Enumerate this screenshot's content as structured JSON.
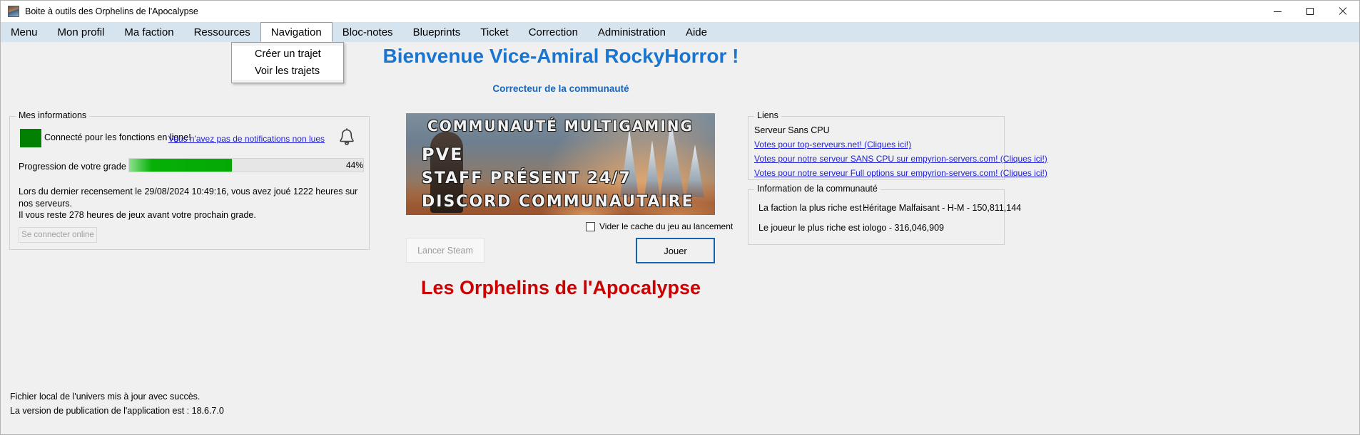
{
  "window": {
    "title": "Boite à outils des Orphelins de l'Apocalypse",
    "minimize": "—",
    "maximize": "▢",
    "close": "✕"
  },
  "menubar": {
    "items": [
      {
        "label": "Menu"
      },
      {
        "label": "Mon profil"
      },
      {
        "label": "Ma faction"
      },
      {
        "label": "Ressources"
      },
      {
        "label": "Navigation"
      },
      {
        "label": "Bloc-notes"
      },
      {
        "label": "Blueprints"
      },
      {
        "label": "Ticket"
      },
      {
        "label": "Correction"
      },
      {
        "label": "Administration"
      },
      {
        "label": "Aide"
      }
    ]
  },
  "dropdown": {
    "items": [
      {
        "label": "Créer un trajet"
      },
      {
        "label": "Voir les trajets"
      }
    ]
  },
  "header": {
    "welcome": "Bienvenue Vice-Amiral RockyHorror !",
    "subtitle": "Correcteur de la communauté",
    "footer_title": "Les Orphelins de l'Apocalypse"
  },
  "infos": {
    "group_title": "Mes informations",
    "status_text": "Connecté pour les fonctions en ligne!",
    "status_color": "#028002",
    "notifications_link": "Vous n'avez pas de notifications non lues",
    "progress_label": "Progression de votre grade :",
    "progress_percent": "44%",
    "progress_value": 44,
    "recensement_line1": "Lors du dernier recensement le 29/08/2024 10:49:16, vous avez joué 1222 heures sur nos serveurs.",
    "recensement_line2": "Il vous reste 278 heures de jeux avant votre prochain grade.",
    "offline_button": "Se connecter online"
  },
  "banner": {
    "line1": "COMMUNAUTÉ MULTIGAMING",
    "line2": "PVE",
    "line3": "STAFF PRÉSENT 24/7",
    "line4": "DISCORD COMMUNAUTAIRE"
  },
  "center": {
    "cache_checkbox_label": "Vider le cache du jeu au lancement",
    "cache_checked": false,
    "steam_button": "Lancer Steam",
    "play_button": "Jouer",
    "play_border_color": "#1465b0"
  },
  "liens": {
    "group_title": "Liens",
    "subtitle": "Serveur Sans CPU",
    "items": [
      {
        "label": "Votes pour top-serveurs.net! (Cliques ici!)"
      },
      {
        "label": "Votes pour notre serveur SANS CPU sur empyrion-servers.com! (Cliques ici!)"
      },
      {
        "label": "Votes pour notre serveur Full options sur empyrion-servers.com! (Cliques ici!)"
      }
    ]
  },
  "communaute": {
    "group_title": "Information de la communauté",
    "richest_faction_label": "La faction la plus riche est :",
    "richest_faction_value": "Héritage Malfaisant - H-M - 150,811,144",
    "richest_player_label": "Le joueur le plus riche est :",
    "richest_player_value": "iologo - 316,046,909"
  },
  "statusbar": {
    "line1": "Fichier local de l'univers mis à jour avec succès.",
    "line2": "La version de publication de l'application est : 18.6.7.0"
  }
}
